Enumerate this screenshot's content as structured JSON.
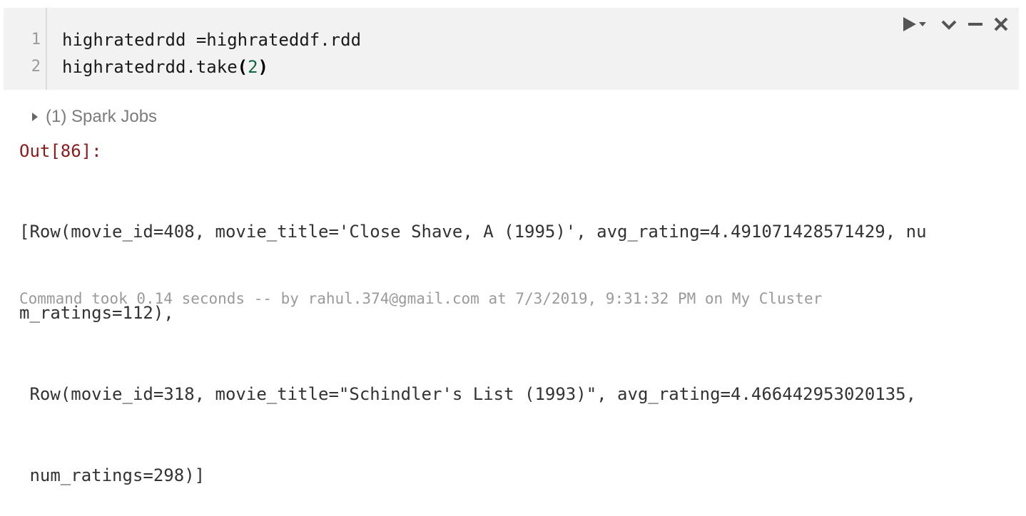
{
  "cell": {
    "lines": [
      {
        "no": "1",
        "text": "highratedrdd =highrateddf.rdd"
      },
      {
        "no": "2",
        "prefix": "highratedrdd.take",
        "open": "(",
        "arg": "2",
        "close": ")"
      }
    ]
  },
  "toolbar": {
    "run_icon": "play-dropdown-icon",
    "collapse_icon": "chevron-down-icon",
    "minimize_icon": "minus-icon",
    "close_icon": "close-icon"
  },
  "spark_jobs": {
    "label": "(1) Spark Jobs"
  },
  "output": {
    "label": "Out[86]:",
    "lines": [
      "[Row(movie_id=408, movie_title='Close Shave, A (1995)', avg_rating=4.491071428571429, nu",
      "m_ratings=112),",
      " Row(movie_id=318, movie_title=\"Schindler's List (1993)\", avg_rating=4.466442953020135,",
      " num_ratings=298)]"
    ]
  },
  "status": {
    "text": "Command took 0.14 seconds -- by rahul.374@gmail.com at 7/3/2019, 9:31:32 PM on My Cluster"
  },
  "colors": {
    "cell_bg": "#f2f2f2",
    "out_label": "#8b1a1a",
    "number": "#116644"
  }
}
